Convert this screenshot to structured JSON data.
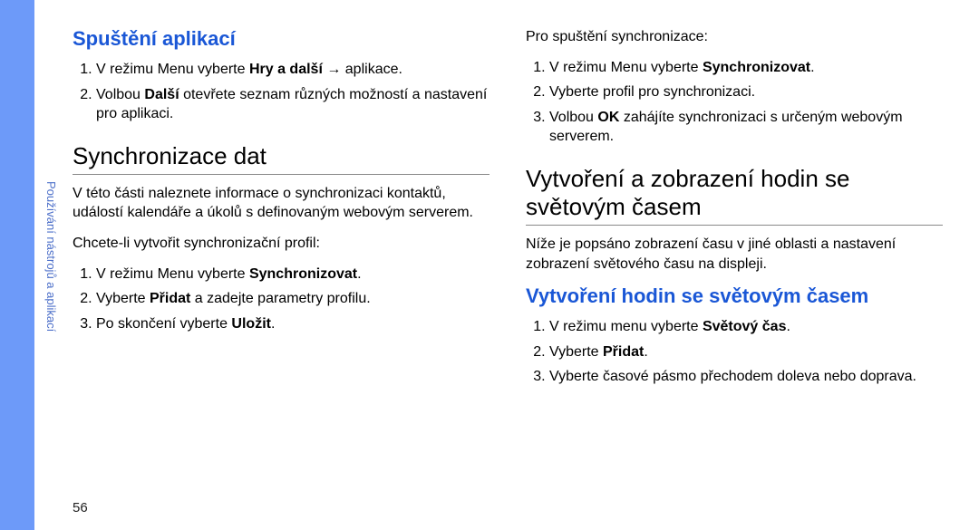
{
  "sideLabel": "Používání nástrojů a aplikací",
  "pageNumber": "56",
  "left": {
    "h_blue": "Spuštění aplikací",
    "ol1_1a": "V režimu Menu vyberte ",
    "ol1_1b": "Hry a další",
    "ol1_1c": " → aplikace.",
    "ol1_2a": "Volbou ",
    "ol1_2b": "Další",
    "ol1_2c": " otevřete seznam různých možností a nastavení pro aplikaci.",
    "h_black": "Synchronizace dat",
    "p1": "V této části naleznete informace o synchronizaci kontaktů, událostí kalendáře a úkolů s definovaným webovým serverem.",
    "p2": "Chcete-li vytvořit synchronizační profil:",
    "ol2_1a": "V režimu Menu vyberte ",
    "ol2_1b": "Synchronizovat",
    "ol2_1c": ".",
    "ol2_2a": "Vyberte ",
    "ol2_2b": "Přidat",
    "ol2_2c": " a zadejte parametry profilu.",
    "ol2_3a": "Po skončení vyberte ",
    "ol2_3b": "Uložit",
    "ol2_3c": "."
  },
  "right": {
    "p1": "Pro spuštění synchronizace:",
    "ol1_1a": "V režimu Menu vyberte ",
    "ol1_1b": "Synchronizovat",
    "ol1_1c": ".",
    "ol1_2": "Vyberte profil pro synchronizaci.",
    "ol1_3a": "Volbou ",
    "ol1_3b": "OK",
    "ol1_3c": " zahájíte synchronizaci s určeným webovým serverem.",
    "h_black": "Vytvoření a zobrazení hodin se světovým časem",
    "p2": "Níže je popsáno zobrazení času v jiné oblasti a nastavení zobrazení světového času na displeji.",
    "h_blue": "Vytvoření hodin se světovým časem",
    "ol2_1a": "V režimu menu vyberte ",
    "ol2_1b": "Světový čas",
    "ol2_1c": ".",
    "ol2_2a": "Vyberte ",
    "ol2_2b": "Přidat",
    "ol2_2c": ".",
    "ol2_3": "Vyberte časové pásmo přechodem doleva nebo doprava."
  }
}
